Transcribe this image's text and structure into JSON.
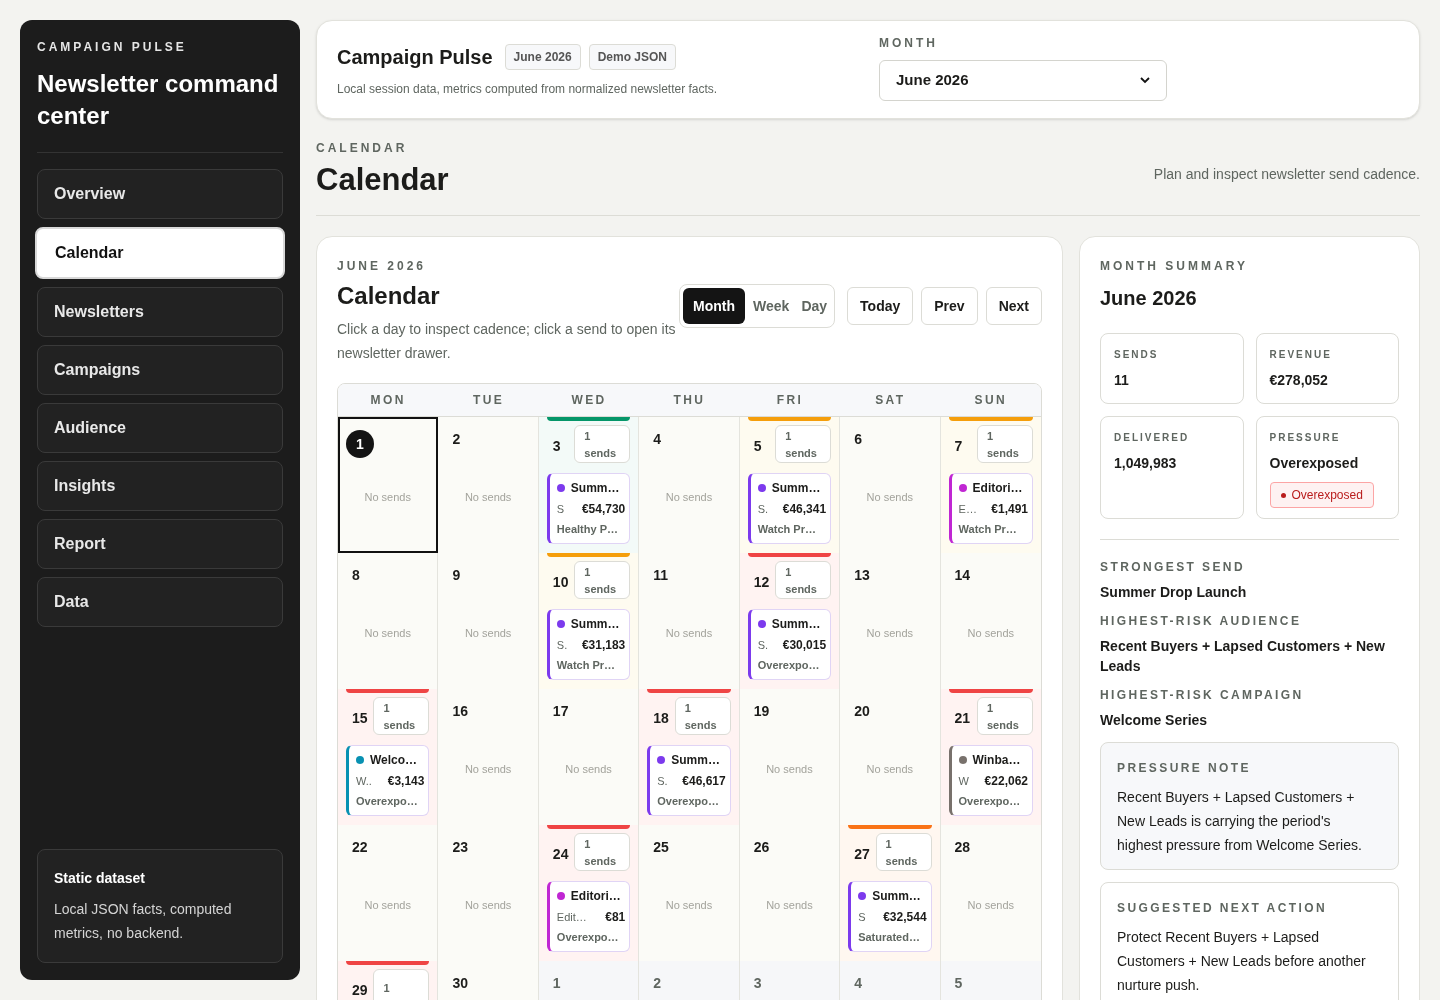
{
  "sidebar": {
    "eyebrow": "CAMPAIGN PULSE",
    "title": "Newsletter command center",
    "items": [
      {
        "label": "Overview",
        "selected": false
      },
      {
        "label": "Calendar",
        "selected": true
      },
      {
        "label": "Newsletters",
        "selected": false
      },
      {
        "label": "Campaigns",
        "selected": false
      },
      {
        "label": "Audience",
        "selected": false
      },
      {
        "label": "Insights",
        "selected": false
      },
      {
        "label": "Report",
        "selected": false
      },
      {
        "label": "Data",
        "selected": false
      }
    ],
    "footer": {
      "title": "Static dataset",
      "text": "Local JSON facts, computed metrics, no backend."
    }
  },
  "header": {
    "title": "Campaign Pulse",
    "badges": [
      "June 2026",
      "Demo JSON"
    ],
    "subtitle": "Local session data, metrics computed from normalized newsletter facts.",
    "month_label": "MONTH",
    "month_value": "June 2026"
  },
  "page": {
    "eyebrow": "CALENDAR",
    "title": "Calendar",
    "description": "Plan and inspect newsletter send cadence."
  },
  "calendar": {
    "eyebrow": "JUNE 2026",
    "title": "Calendar",
    "hint": "Click a day to inspect cadence; click a send to open its newsletter drawer.",
    "views": [
      {
        "label": "Month",
        "selected": true
      },
      {
        "label": "Week",
        "selected": false
      },
      {
        "label": "Day",
        "selected": false
      }
    ],
    "nav_buttons": [
      "Today",
      "Prev",
      "Next"
    ],
    "weekdays": [
      "MON",
      "TUE",
      "WED",
      "THU",
      "FRI",
      "SAT",
      "SUN"
    ],
    "weeks": [
      [
        {
          "day": "1",
          "in_month": true,
          "selected": true,
          "kind": "plain",
          "empty": "No sends"
        },
        {
          "day": "2",
          "in_month": true,
          "selected": false,
          "kind": "plain",
          "empty": "No sends"
        },
        {
          "day": "3",
          "in_month": true,
          "selected": false,
          "kind": "healthy",
          "count": "1",
          "count_label": "sends",
          "sends": [
            {
              "title": "Summ…",
              "segment": "S",
              "revenue": "€54,730",
              "status": "Healthy P…",
              "color": "#7c3aed"
            }
          ]
        },
        {
          "day": "4",
          "in_month": true,
          "selected": false,
          "kind": "plain",
          "empty": "No sends"
        },
        {
          "day": "5",
          "in_month": true,
          "selected": false,
          "kind": "watch",
          "count": "1",
          "count_label": "sends",
          "sends": [
            {
              "title": "Summ…",
              "segment": "S.",
              "revenue": "€46,341",
              "status": "Watch Pr…",
              "color": "#7c3aed"
            }
          ]
        },
        {
          "day": "6",
          "in_month": true,
          "selected": false,
          "kind": "plain",
          "empty": "No sends"
        },
        {
          "day": "7",
          "in_month": true,
          "selected": false,
          "kind": "watch",
          "count": "1",
          "count_label": "sends",
          "sends": [
            {
              "title": "Editori…",
              "segment": "E…",
              "revenue": "€1,491",
              "status": "Watch Pr…",
              "color": "#c026d3"
            }
          ]
        }
      ],
      [
        {
          "day": "8",
          "in_month": true,
          "selected": false,
          "kind": "plain",
          "empty": "No sends"
        },
        {
          "day": "9",
          "in_month": true,
          "selected": false,
          "kind": "plain",
          "empty": "No sends"
        },
        {
          "day": "10",
          "in_month": true,
          "selected": false,
          "kind": "watch",
          "count": "1",
          "count_label": "sends",
          "sends": [
            {
              "title": "Summ…",
              "segment": "S.",
              "revenue": "€31,183",
              "status": "Watch Pr…",
              "color": "#7c3aed"
            }
          ]
        },
        {
          "day": "11",
          "in_month": true,
          "selected": false,
          "kind": "plain",
          "empty": "No sends"
        },
        {
          "day": "12",
          "in_month": true,
          "selected": false,
          "kind": "overexposed",
          "count": "1",
          "count_label": "sends",
          "sends": [
            {
              "title": "Summ…",
              "segment": "S.",
              "revenue": "€30,015",
              "status": "Overexpo…",
              "color": "#7c3aed"
            }
          ]
        },
        {
          "day": "13",
          "in_month": true,
          "selected": false,
          "kind": "plain",
          "empty": "No sends"
        },
        {
          "day": "14",
          "in_month": true,
          "selected": false,
          "kind": "plain",
          "empty": "No sends"
        }
      ],
      [
        {
          "day": "15",
          "in_month": true,
          "selected": false,
          "kind": "overexposed",
          "count": "1",
          "count_label": "sends",
          "sends": [
            {
              "title": "Welco…",
              "segment": "W..",
              "revenue": "€3,143",
              "status": "Overexpo…",
              "color": "#0891b2"
            }
          ]
        },
        {
          "day": "16",
          "in_month": true,
          "selected": false,
          "kind": "plain",
          "empty": "No sends"
        },
        {
          "day": "17",
          "in_month": true,
          "selected": false,
          "kind": "plain",
          "empty": "No sends"
        },
        {
          "day": "18",
          "in_month": true,
          "selected": false,
          "kind": "overexposed",
          "count": "1",
          "count_label": "sends",
          "sends": [
            {
              "title": "Summ…",
              "segment": "S.",
              "revenue": "€46,617",
              "status": "Overexpo…",
              "color": "#7c3aed"
            }
          ]
        },
        {
          "day": "19",
          "in_month": true,
          "selected": false,
          "kind": "plain",
          "empty": "No sends"
        },
        {
          "day": "20",
          "in_month": true,
          "selected": false,
          "kind": "plain",
          "empty": "No sends"
        },
        {
          "day": "21",
          "in_month": true,
          "selected": false,
          "kind": "overexposed",
          "count": "1",
          "count_label": "sends",
          "sends": [
            {
              "title": "Winba…",
              "segment": "W",
              "revenue": "€22,062",
              "status": "Overexpo…",
              "color": "#78716c"
            }
          ]
        }
      ],
      [
        {
          "day": "22",
          "in_month": true,
          "selected": false,
          "kind": "plain",
          "empty": "No sends"
        },
        {
          "day": "23",
          "in_month": true,
          "selected": false,
          "kind": "plain",
          "empty": "No sends"
        },
        {
          "day": "24",
          "in_month": true,
          "selected": false,
          "kind": "overexposed",
          "count": "1",
          "count_label": "sends",
          "sends": [
            {
              "title": "Editori…",
              "segment": "Edit…",
              "revenue": "€81",
              "status": "Overexpo…",
              "color": "#c026d3"
            }
          ]
        },
        {
          "day": "25",
          "in_month": true,
          "selected": false,
          "kind": "plain",
          "empty": "No sends"
        },
        {
          "day": "26",
          "in_month": true,
          "selected": false,
          "kind": "plain",
          "empty": "No sends"
        },
        {
          "day": "27",
          "in_month": true,
          "selected": false,
          "kind": "saturated",
          "count": "1",
          "count_label": "sends",
          "sends": [
            {
              "title": "Summ…",
              "segment": "S",
              "revenue": "€32,544",
              "status": "Saturated…",
              "color": "#7c3aed"
            }
          ]
        },
        {
          "day": "28",
          "in_month": true,
          "selected": false,
          "kind": "plain",
          "empty": "No sends"
        }
      ],
      [
        {
          "day": "29",
          "in_month": true,
          "selected": false,
          "kind": "overexposed",
          "count": "1"
        },
        {
          "day": "30",
          "in_month": true,
          "selected": false,
          "kind": "plain"
        },
        {
          "day": "1",
          "in_month": false,
          "selected": false,
          "kind": "plain"
        },
        {
          "day": "2",
          "in_month": false,
          "selected": false,
          "kind": "plain"
        },
        {
          "day": "3",
          "in_month": false,
          "selected": false,
          "kind": "plain"
        },
        {
          "day": "4",
          "in_month": false,
          "selected": false,
          "kind": "plain"
        },
        {
          "day": "5",
          "in_month": false,
          "selected": false,
          "kind": "plain"
        }
      ]
    ]
  },
  "summary": {
    "eyebrow": "MONTH SUMMARY",
    "title": "June 2026",
    "metrics": [
      {
        "label": "SENDS",
        "value": "11"
      },
      {
        "label": "REVENUE",
        "value": "€278,052"
      },
      {
        "label": "DELIVERED",
        "value": "1,049,983"
      },
      {
        "label": "PRESSURE",
        "value": "Overexposed",
        "badge": "Overexposed"
      }
    ],
    "facts": [
      {
        "label": "STRONGEST SEND",
        "value": "Summer Drop Launch"
      },
      {
        "label": "HIGHEST-RISK AUDIENCE",
        "value": "Recent Buyers + Lapsed Customers + New Leads"
      },
      {
        "label": "HIGHEST-RISK CAMPAIGN",
        "value": "Welcome Series"
      }
    ],
    "notes": [
      {
        "kind": "tinted",
        "label": "PRESSURE NOTE",
        "text": "Recent Buyers + Lapsed Customers + New Leads is carrying the period's highest pressure from Welcome Series."
      },
      {
        "kind": "plain",
        "label": "SUGGESTED NEXT ACTION",
        "text": "Protect Recent Buyers + Lapsed Customers + New Leads before another nurture push."
      }
    ]
  }
}
